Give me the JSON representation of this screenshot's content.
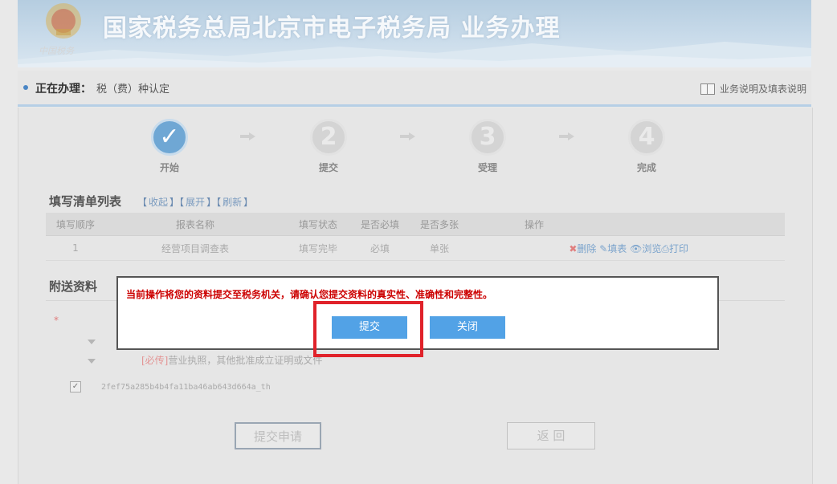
{
  "header": {
    "title": "国家税务总局北京市电子税务局  业务办理",
    "emblem_caption": "中国税务"
  },
  "breadcrumb": {
    "label": "正在办理：",
    "value": "税（费）种认定",
    "help": "业务说明及填表说明"
  },
  "steps": [
    {
      "label": "开始",
      "mark": "✓",
      "active": true
    },
    {
      "label": "提交",
      "mark": "2",
      "active": false
    },
    {
      "label": "受理",
      "mark": "3",
      "active": false
    },
    {
      "label": "完成",
      "mark": "4",
      "active": false
    }
  ],
  "form_list": {
    "title": "填写清单列表",
    "collapse": "收起",
    "expand": "展开",
    "refresh": "刷新",
    "columns": [
      "填写顺序",
      "报表名称",
      "填写状态",
      "是否必填",
      "是否多张",
      "操作"
    ],
    "rows": [
      {
        "order": "1",
        "name": "经营项目调查表",
        "status": "填写完毕",
        "required": "必填",
        "multiple": "单张"
      }
    ],
    "ops": {
      "delete": "删除",
      "fill": "填表",
      "browse": "浏览",
      "print": "打印"
    }
  },
  "attachments": {
    "title": "附送资料",
    "required_tag": "[必传]",
    "item": "营业执照，其他批准成立证明或文件",
    "file": "2fef75a285b4b4fa11ba46ab643d664a_th"
  },
  "buttons": {
    "submit_apply": "提交申请",
    "back": "返 回"
  },
  "modal": {
    "message": "当前操作将您的资料提交至税务机关，请确认您提交资料的真实性、准确性和完整性。",
    "submit": "提交",
    "close": "关闭"
  }
}
